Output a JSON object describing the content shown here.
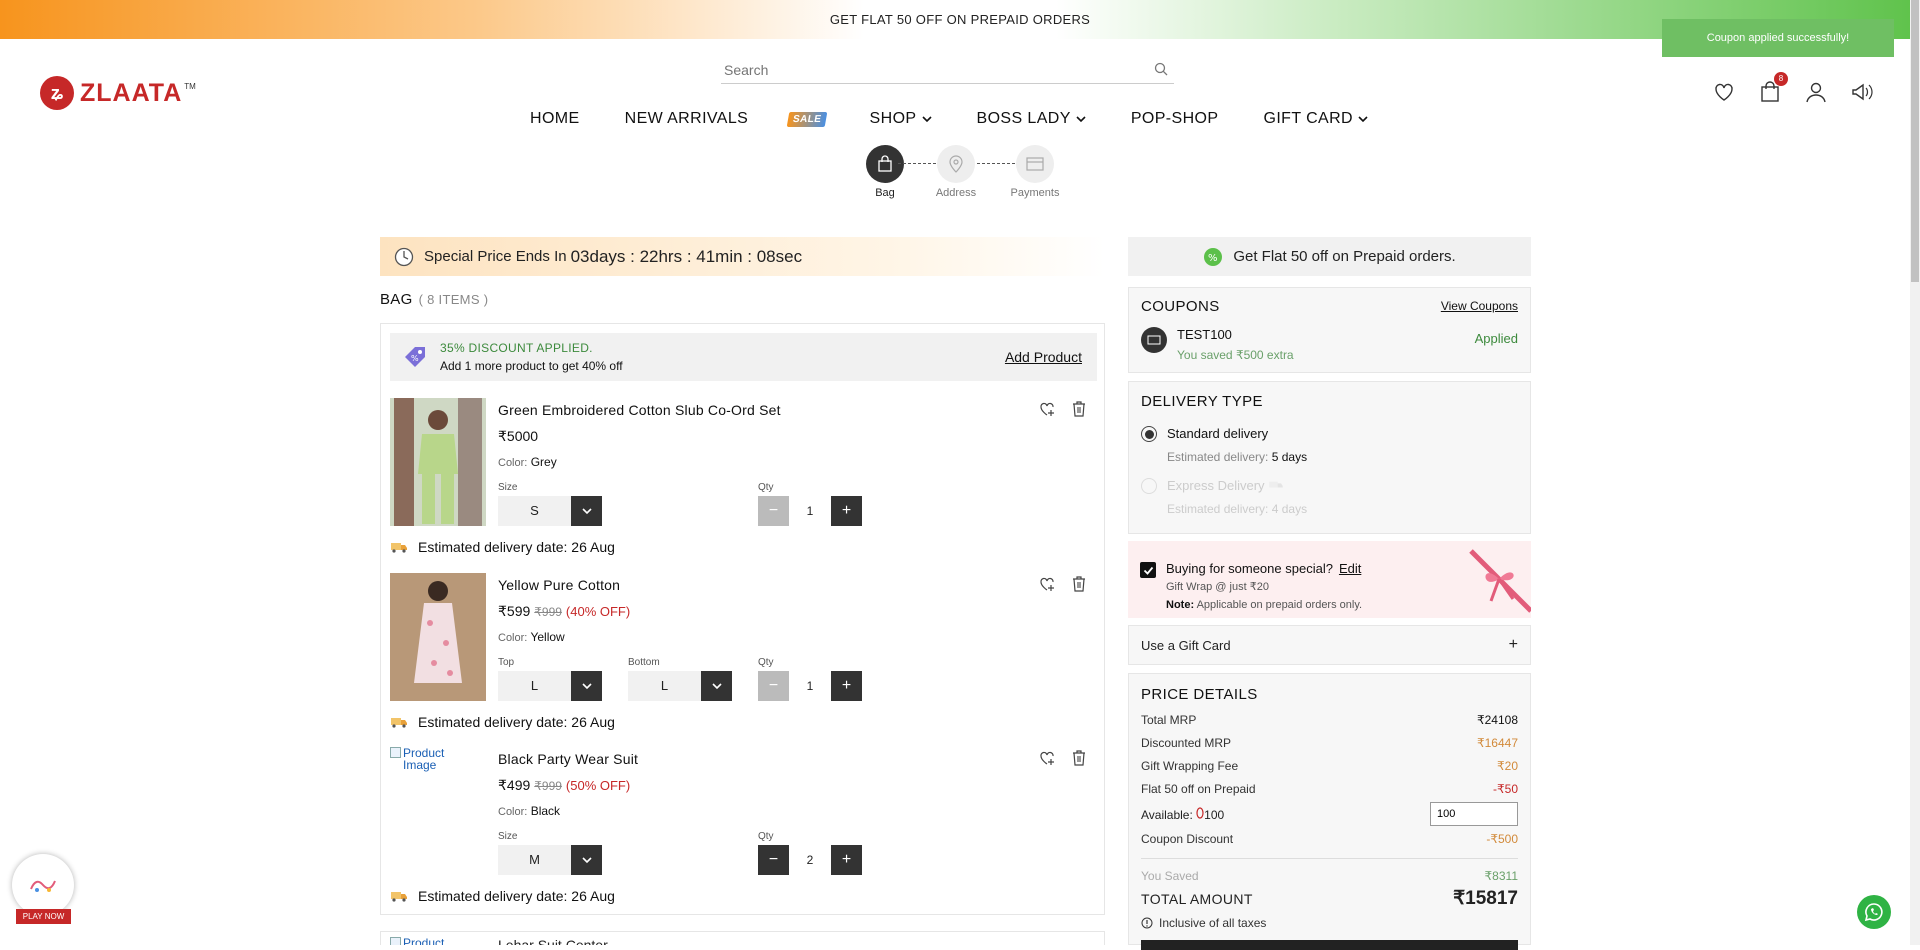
{
  "announcement": "GET FLAT 50 OFF ON PREPAID ORDERS",
  "toast": "Coupon applied successfully!",
  "brand": {
    "name": "ZLAATA",
    "tm": "TM"
  },
  "search": {
    "placeholder": "Search"
  },
  "nav": [
    "HOME",
    "NEW ARRIVALS",
    "SALE",
    "SHOP",
    "BOSS LADY",
    "POP-SHOP",
    "GIFT CARD"
  ],
  "header": {
    "cart_count": "8"
  },
  "steps": [
    "Bag",
    "Address",
    "Payments"
  ],
  "timer": {
    "prefix": "Special Price Ends In",
    "value": "03days : 22hrs : 41min : 08sec"
  },
  "bag": {
    "title": "BAG",
    "count": "( 8 ITEMS )"
  },
  "discount": {
    "applied": "35% DISCOUNT APPLIED.",
    "hint": "Add 1 more product to get 40% off",
    "add_product": "Add Product"
  },
  "products": [
    {
      "name": "Green Embroidered Cotton Slub Co-Ord Set",
      "price": "₹5000",
      "mrp": "",
      "off": "",
      "color_label": "Color:",
      "color": "Grey",
      "selects": [
        {
          "label": "Size",
          "value": "S"
        }
      ],
      "qty_label": "Qty",
      "qty": "1",
      "delivery": "Estimated delivery date: 26 Aug"
    },
    {
      "name": "Yellow Pure Cotton",
      "price": "₹599",
      "mrp": "₹999",
      "off": "(40% OFF)",
      "color_label": "Color:",
      "color": "Yellow",
      "selects": [
        {
          "label": "Top",
          "value": "L"
        },
        {
          "label": "Bottom",
          "value": "L"
        }
      ],
      "qty_label": "Qty",
      "qty": "1",
      "delivery": "Estimated delivery date: 26 Aug"
    },
    {
      "name": "Black Party Wear Suit",
      "price": "₹499",
      "mrp": "₹999",
      "off": "(50% OFF)",
      "color_label": "Color:",
      "color": "Black",
      "image_alt": "Product Image",
      "selects": [
        {
          "label": "Size",
          "value": "M"
        }
      ],
      "qty_label": "Qty",
      "qty": "2",
      "delivery": "Estimated delivery date: 26 Aug"
    },
    {
      "name": "Lehar Suit Center",
      "image_alt": "Product"
    }
  ],
  "promo": "Get Flat 50 off on Prepaid orders.",
  "coupons": {
    "title": "COUPONS",
    "view": "View Coupons",
    "code": "TEST100",
    "saved": "You saved ₹500 extra",
    "status": "Applied"
  },
  "delivery": {
    "title": "DELIVERY TYPE",
    "options": [
      {
        "name": "Standard delivery",
        "est_label": "Estimated delivery:",
        "est": "5 days"
      },
      {
        "name": "Express Delivery",
        "est_label": "Estimated delivery:",
        "est": "4 days"
      }
    ]
  },
  "gift": {
    "title": "Buying for someone special?",
    "edit": "Edit",
    "fee": "Gift Wrap @ just ₹20",
    "note_label": "Note:",
    "note": "Applicable on prepaid orders only."
  },
  "gift_card": {
    "label": "Use a Gift Card",
    "toggle": "+"
  },
  "price": {
    "title": "PRICE DETAILS",
    "rows": [
      {
        "label": "Total MRP",
        "value": "₹24108"
      },
      {
        "label": "Discounted MRP",
        "value": "₹16447"
      },
      {
        "label": "Gift Wrapping Fee",
        "value": "₹20"
      },
      {
        "label": "Flat 50 off on Prepaid",
        "value": "-₹50"
      }
    ],
    "available_label": "Available:",
    "available": "100",
    "available_input": "100",
    "coupon_label": "Coupon Discount",
    "coupon_value": "-₹500",
    "saved_label": "You Saved",
    "saved_value": "₹8311",
    "total_label": "TOTAL AMOUNT",
    "total_value": "₹15817",
    "incl": "Inclusive of all taxes"
  },
  "play": {
    "label": "PLAY NOW"
  },
  "colors": {
    "brand_red": "#c62828",
    "green": "#3c8a3c",
    "dark": "#333333"
  }
}
